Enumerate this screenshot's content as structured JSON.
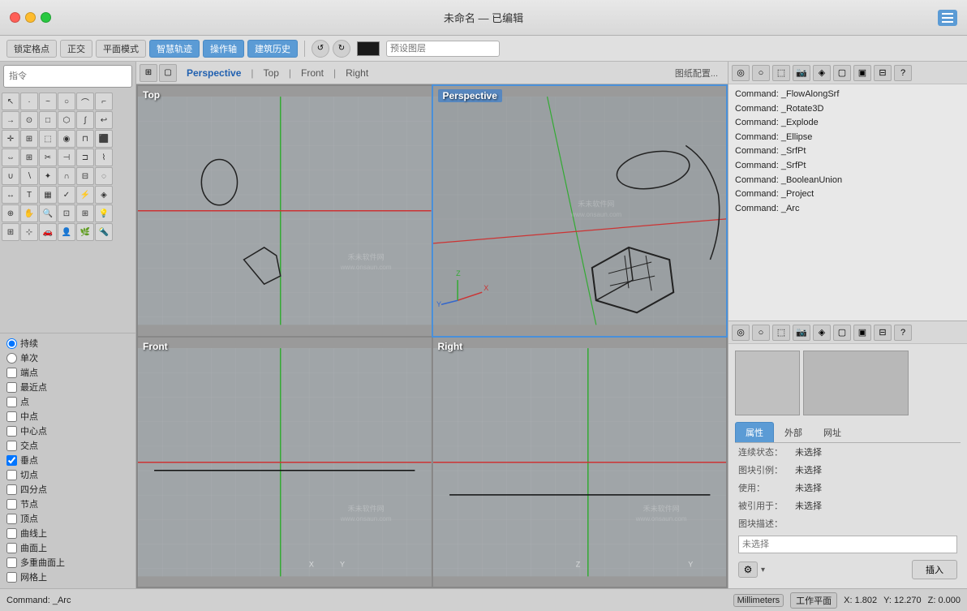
{
  "titlebar": {
    "title": "未命名 — 已编辑",
    "traffic": [
      "close",
      "minimize",
      "maximize"
    ],
    "sidebar_icon": "sidebar-icon"
  },
  "toolbar": {
    "lock_grid": "锁定格点",
    "ortho": "正交",
    "planar": "平面模式",
    "smart_track": "智慧轨迹",
    "operation_axis": "操作轴",
    "build_history": "建筑历史",
    "preset_layer": "预设图层"
  },
  "viewport_tabs": {
    "icons": [
      "grid-icon",
      "rect-icon"
    ],
    "tabs": [
      "Perspective",
      "Top",
      "Front",
      "Right"
    ],
    "active": "Perspective",
    "config_btn": "图纸配置..."
  },
  "viewports": [
    {
      "id": "top-left",
      "label": "Top",
      "active": false
    },
    {
      "id": "top-right",
      "label": "Perspective",
      "active": true
    },
    {
      "id": "bottom-left",
      "label": "Front",
      "active": false
    },
    {
      "id": "bottom-right",
      "label": "Right",
      "active": false
    }
  ],
  "command_history": {
    "lines": [
      "Command: _FlowAlongSrf",
      "Command: _Rotate3D",
      "Command: _Explode",
      "Command: _Ellipse",
      "Command: _SrfPt",
      "Command: _SrfPt",
      "Command: _BooleanUnion",
      "Command: _Project",
      "Command: _Arc"
    ]
  },
  "properties": {
    "tabs": [
      "属性",
      "外部",
      "网址"
    ],
    "active_tab": "属性",
    "rows": [
      {
        "label": "连续状态：",
        "value": "未选择"
      },
      {
        "label": "图块引例：",
        "value": "未选择"
      },
      {
        "label": "使用：",
        "value": "未选择"
      },
      {
        "label": "被引用于：",
        "value": "未选择"
      },
      {
        "label": "图块描述：",
        "value": ""
      }
    ],
    "desc_placeholder": "未选择",
    "insert_btn": "插入"
  },
  "left_sidebar": {
    "command_placeholder": "指令"
  },
  "snap_panel": {
    "items": [
      {
        "type": "radio",
        "label": "持续",
        "checked": true
      },
      {
        "type": "radio",
        "label": "单次",
        "checked": false
      },
      {
        "type": "check",
        "label": "端点",
        "checked": false
      },
      {
        "type": "check",
        "label": "最近点",
        "checked": false
      },
      {
        "type": "check",
        "label": "点",
        "checked": false
      },
      {
        "type": "check",
        "label": "中点",
        "checked": false
      },
      {
        "type": "check",
        "label": "中心点",
        "checked": false
      },
      {
        "type": "check",
        "label": "交点",
        "checked": false
      },
      {
        "type": "check",
        "label": "垂点",
        "checked": true
      },
      {
        "type": "check",
        "label": "切点",
        "checked": false
      },
      {
        "type": "check",
        "label": "四分点",
        "checked": false
      },
      {
        "type": "check",
        "label": "节点",
        "checked": false
      },
      {
        "type": "check",
        "label": "顶点",
        "checked": false
      },
      {
        "type": "check",
        "label": "曲线上",
        "checked": false
      },
      {
        "type": "check",
        "label": "曲面上",
        "checked": false
      },
      {
        "type": "check",
        "label": "多重曲面上",
        "checked": false
      },
      {
        "type": "check",
        "label": "网格上",
        "checked": false
      }
    ]
  },
  "statusbar": {
    "command": "Command: _Arc",
    "units": "Millimeters",
    "workplane": "工作平面",
    "x": "X: 1.802",
    "y": "Y: 12.270",
    "z": "Z: 0.000"
  },
  "colors": {
    "accent_blue": "#5b9bd5",
    "vp_active_outline": "#4a90d9",
    "grid_line": "rgba(255,255,255,0.15)",
    "axis_red": "#cc3333",
    "axis_green": "#33aa33",
    "axis_blue": "#3366cc"
  }
}
